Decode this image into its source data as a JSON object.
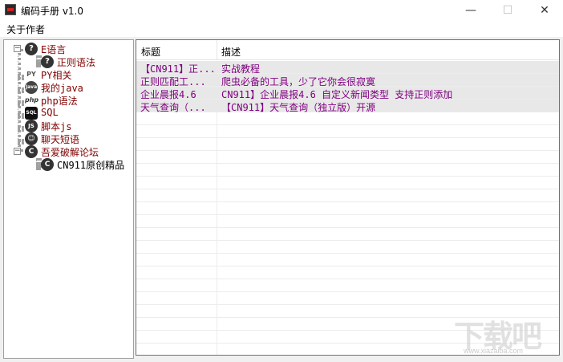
{
  "window": {
    "title": "编码手册 v1.0",
    "controls": {
      "minimize": "—",
      "maximize": "☐",
      "close": "✕"
    }
  },
  "menu": {
    "about": "关于作者"
  },
  "tree": {
    "nodes": [
      {
        "label": "E语言",
        "icon": "question-icon"
      },
      {
        "label": "正则语法",
        "icon": "question-icon"
      },
      {
        "label": "PY相关",
        "icon": "python-icon"
      },
      {
        "label": "我的java",
        "icon": "java-icon"
      },
      {
        "label": "php语法",
        "icon": "php-icon"
      },
      {
        "label": "SQL",
        "icon": "sql-icon"
      },
      {
        "label": "脚本js",
        "icon": "js-icon"
      },
      {
        "label": "聊天短语",
        "icon": "chat-icon"
      },
      {
        "label": "吾爱破解论坛",
        "icon": "forum-icon"
      },
      {
        "label": "CN911原创精品",
        "icon": "forum-icon"
      }
    ],
    "icon_text": {
      "q": "?",
      "py": "PY",
      "java": "Java",
      "php": "php",
      "sql": "SQL",
      "js": "JS",
      "chat": "☺",
      "cn": "C"
    },
    "expander_minus": "−"
  },
  "list": {
    "columns": [
      "标题",
      "描述"
    ],
    "rows": [
      {
        "title": "【CN911】正...",
        "desc": "实战教程"
      },
      {
        "title": "正则匹配工...",
        "desc": "爬虫必备的工具，少了它你会很寂寞"
      },
      {
        "title": "企业晨报4.6",
        "desc": "CN911】企业晨报4.6 自定义新闻类型 支持正则添加"
      },
      {
        "title": "天气查询（...",
        "desc": "【CN911】天气查询（独立版）开源"
      }
    ],
    "text_color": "#800080"
  },
  "watermark": {
    "text": "下载吧",
    "url": "www.xiazaiba.com"
  }
}
